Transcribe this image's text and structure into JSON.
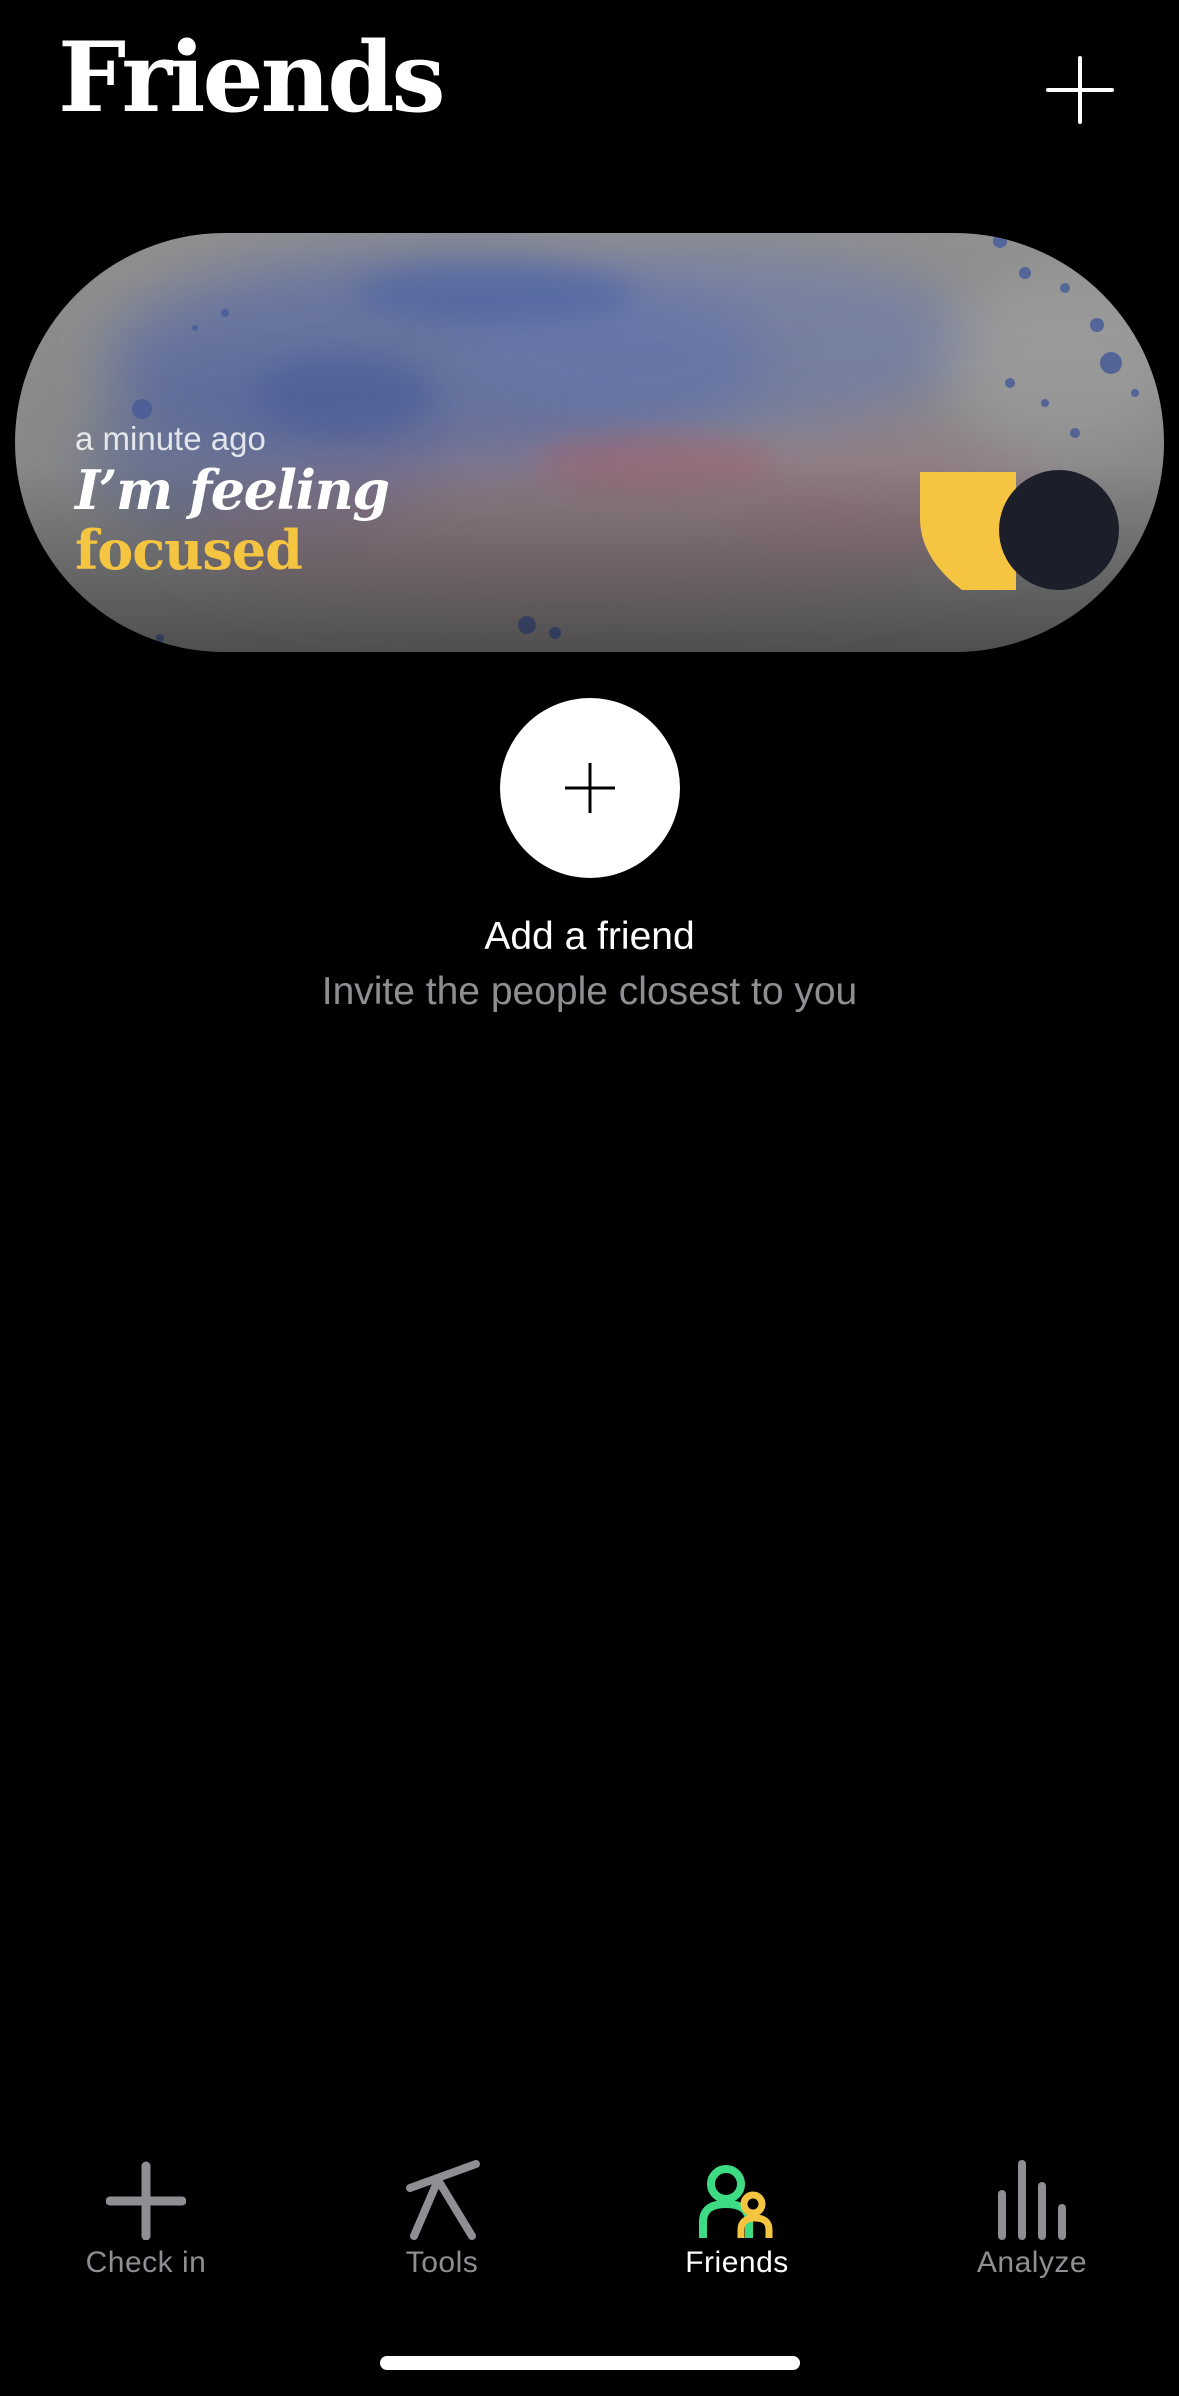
{
  "header": {
    "title": "Friends",
    "add_icon": "plus-icon"
  },
  "mood_card": {
    "time": "a minute ago",
    "feeling_prefix": "I’m feeling",
    "emotion": "focused",
    "emotion_color": "#f5c542"
  },
  "add_friend": {
    "icon": "plus-icon",
    "title": "Add a friend",
    "subtitle": "Invite the people closest to you"
  },
  "tab_bar": {
    "active_color": "#3ddc84",
    "tabs": [
      {
        "label": "Check in",
        "icon": "plus-icon"
      },
      {
        "label": "Tools",
        "icon": "tools-icon"
      },
      {
        "label": "Friends",
        "icon": "friends-icon",
        "active": true
      },
      {
        "label": "Analyze",
        "icon": "bar-chart-icon"
      }
    ]
  }
}
